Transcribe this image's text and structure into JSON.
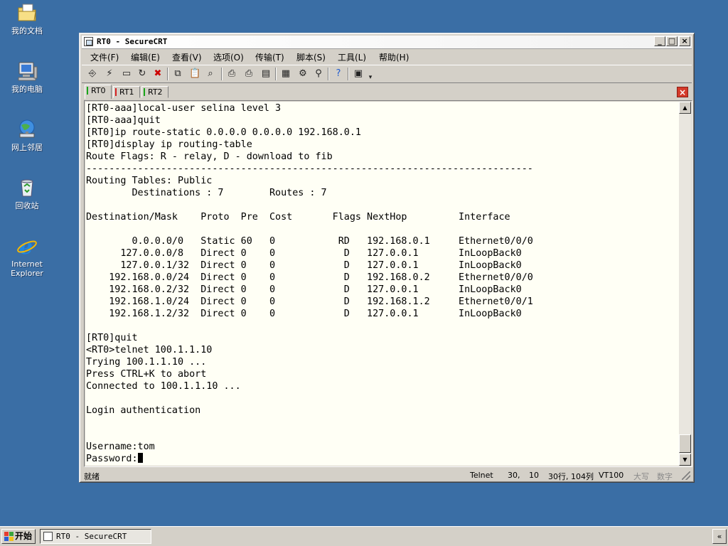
{
  "desktop": {
    "icons": [
      {
        "label": "我的文档",
        "icon": "my-documents-icon"
      },
      {
        "label": "我的电脑",
        "icon": "my-computer-icon"
      },
      {
        "label": "网上邻居",
        "icon": "network-places-icon"
      },
      {
        "label": "回收站",
        "icon": "recycle-bin-icon"
      },
      {
        "label_line1": "Internet",
        "label_line2": "Explorer",
        "icon": "internet-explorer-icon"
      }
    ]
  },
  "window": {
    "title": "RT0 - SecureCRT",
    "controls": {
      "minimize": "_",
      "maximize": "□",
      "close": "×"
    },
    "menu": [
      "文件(F)",
      "编辑(E)",
      "查看(V)",
      "选项(O)",
      "传输(T)",
      "脚本(S)",
      "工具(L)",
      "帮助(H)"
    ],
    "toolbar_icons": [
      "connect-icon",
      "quick-connect-icon",
      "connect-tab-icon",
      "reconnect-icon",
      "disconnect-icon",
      "copy-icon",
      "paste-icon",
      "find-icon",
      "print-icon",
      "print-selection-icon",
      "print-setup-icon",
      "session-options-icon",
      "global-options-icon",
      "keymap-icon",
      "help-icon",
      "sftp-icon"
    ],
    "tabs": [
      {
        "label": "RT0",
        "status_color": "#19a619",
        "active": true
      },
      {
        "label": "RT1",
        "status_color": "#d42020",
        "active": false
      },
      {
        "label": "RT2",
        "status_color": "#19a619",
        "active": false
      }
    ],
    "close_tab_label": "×",
    "terminal": {
      "lines": [
        "[RT0-aaa]local-user selina level 3",
        "[RT0-aaa]quit",
        "[RT0]ip route-static 0.0.0.0 0.0.0.0 192.168.0.1",
        "[RT0]display ip routing-table",
        "Route Flags: R - relay, D - download to fib",
        "------------------------------------------------------------------------------",
        "Routing Tables: Public",
        "        Destinations : 7        Routes : 7",
        "",
        "Destination/Mask    Proto  Pre  Cost       Flags NextHop         Interface",
        "",
        "        0.0.0.0/0   Static 60   0           RD   192.168.0.1     Ethernet0/0/0",
        "      127.0.0.0/8   Direct 0    0            D   127.0.0.1       InLoopBack0",
        "      127.0.0.1/32  Direct 0    0            D   127.0.0.1       InLoopBack0",
        "    192.168.0.0/24  Direct 0    0            D   192.168.0.2     Ethernet0/0/0",
        "    192.168.0.2/32  Direct 0    0            D   127.0.0.1       InLoopBack0",
        "    192.168.1.0/24  Direct 0    0            D   192.168.1.2     Ethernet0/0/1",
        "    192.168.1.2/32  Direct 0    0            D   127.0.0.1       InLoopBack0",
        "",
        "[RT0]quit",
        "<RT0>telnet 100.1.1.10",
        "Trying 100.1.1.10 ...",
        "Press CTRL+K to abort",
        "Connected to 100.1.1.10 ...",
        "",
        "Login authentication",
        "",
        "",
        "Username:tom"
      ],
      "prompt_line": "Password:"
    },
    "status": {
      "ready": "就绪",
      "protocol": "Telnet",
      "row": "30,",
      "col": "10",
      "size": "30行, 104列",
      "emulation": "VT100",
      "caps": "大写",
      "num": "数字"
    }
  },
  "taskbar": {
    "start_label": "开始",
    "tasks": [
      {
        "label": "RT0 - SecureCRT"
      }
    ],
    "tray_toggle": "«"
  }
}
